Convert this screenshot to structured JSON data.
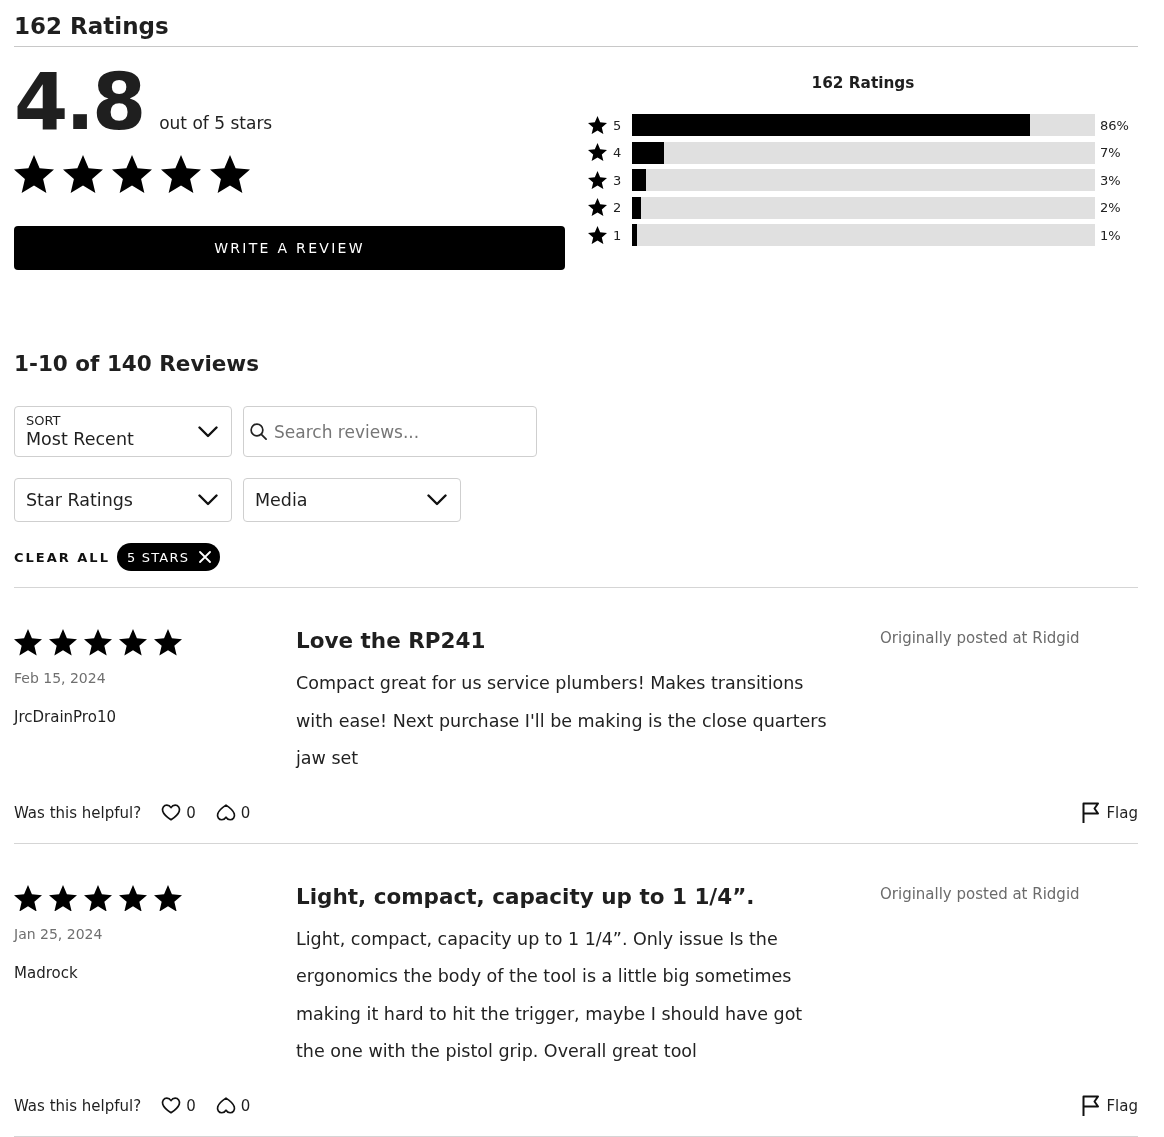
{
  "header": {
    "title": "162 Ratings"
  },
  "summary": {
    "average": "4.8",
    "out_of": "out of 5 stars",
    "stars": 5,
    "write_review_button": "WRITE A REVIEW"
  },
  "histogram": {
    "title": "162 Ratings",
    "rows": [
      {
        "stars_label": "5",
        "level": 0.86,
        "percent": "86%"
      },
      {
        "stars_label": "4",
        "level": 0.07,
        "percent": "7%"
      },
      {
        "stars_label": "3",
        "level": 0.03,
        "percent": "3%"
      },
      {
        "stars_label": "2",
        "level": 0.02,
        "percent": "2%"
      },
      {
        "stars_label": "1",
        "level": 0.01,
        "percent": "1%"
      }
    ]
  },
  "reviews_header": {
    "title": "1-10 of 140 Reviews"
  },
  "filters": {
    "sort": {
      "label": "SORT",
      "value": "Most Recent"
    },
    "search": {
      "placeholder": "Search reviews..."
    },
    "dropdowns": [
      {
        "label": "Star Ratings"
      },
      {
        "label": "Media"
      }
    ],
    "clear_all": "CLEAR ALL",
    "active_filters": [
      {
        "label": "5 STARS"
      }
    ]
  },
  "reviews": [
    {
      "stars": 5,
      "date": "Feb 15, 2024",
      "author": "JrcDrainPro10",
      "title": "Love the RP241",
      "body": "Compact great for us service plumbers! Makes transitions with ease! Next purchase I'll be making is the close quarters jaw set",
      "source": "Originally posted at Ridgid",
      "helpful_prompt": "Was this helpful?",
      "helpful_votes": "0",
      "unhelpful_votes": "0",
      "flag": "Flag"
    },
    {
      "stars": 5,
      "date": "Jan 25, 2024",
      "author": "Madrock",
      "title": "Light, compact, capacity up to 1 1/4”.",
      "body": "Light, compact, capacity up to 1 1/4”. Only issue Is the ergonomics the body of the tool is a little big sometimes making it hard to hit the trigger, maybe I should have got the one with the pistol grip. Overall great tool",
      "source": "Originally posted at Ridgid",
      "helpful_prompt": "Was this helpful?",
      "helpful_votes": "0",
      "unhelpful_votes": "0",
      "flag": "Flag"
    }
  ]
}
